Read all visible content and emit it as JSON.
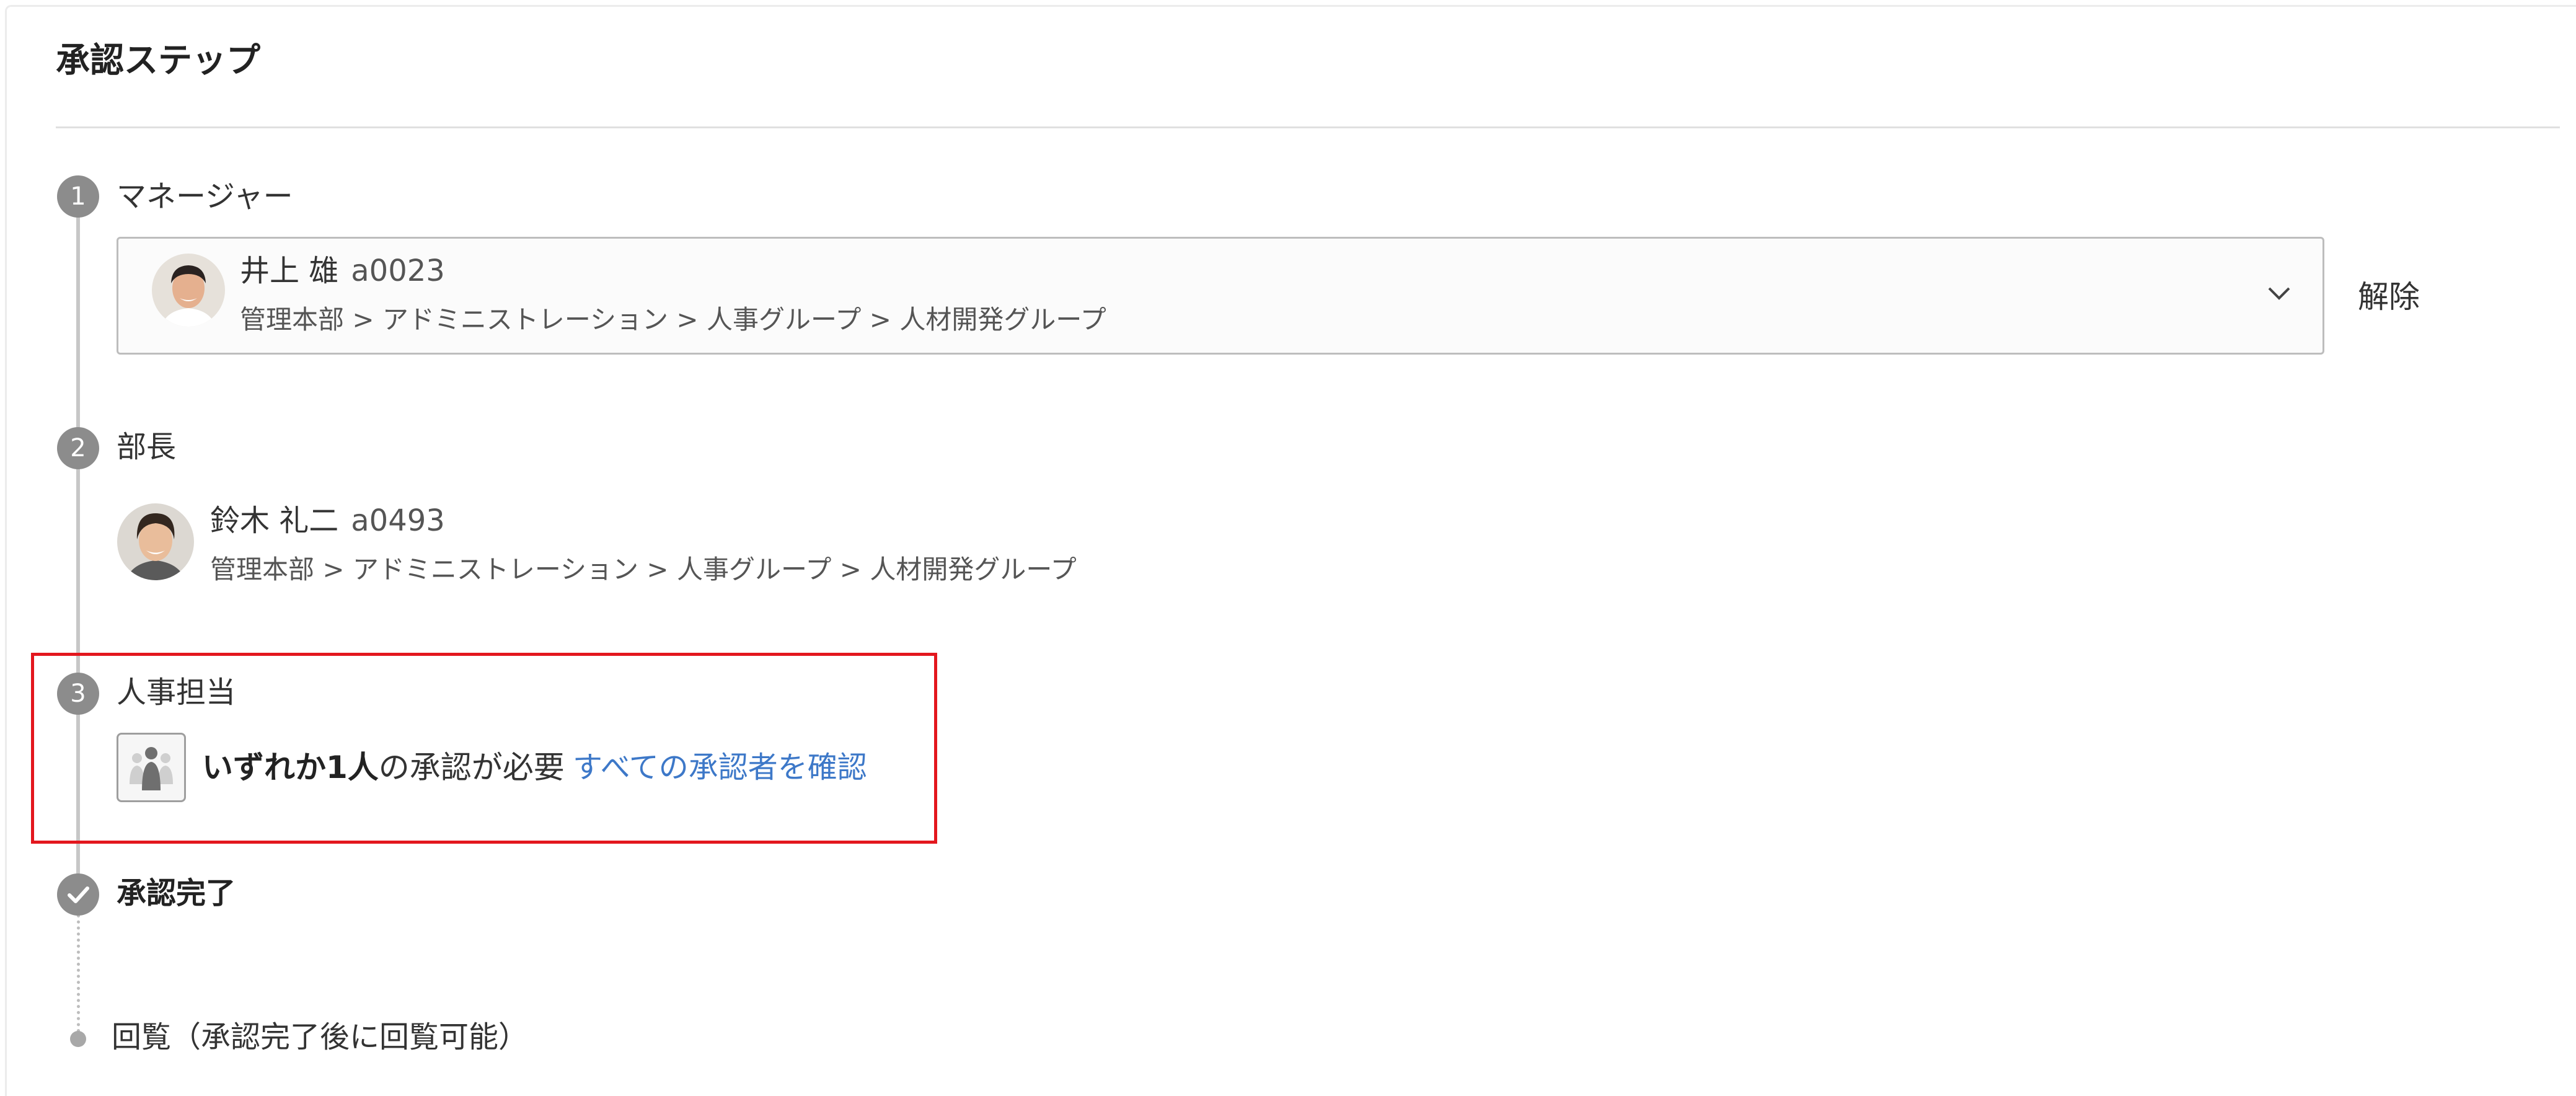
{
  "header": {
    "title": "承認ステップ"
  },
  "steps": [
    {
      "number": "1",
      "label": "マネージャー",
      "approver": {
        "name": "井上 雄",
        "code": "a0023",
        "department": "管理本部 > アドミニストレーション > 人事グループ > 人材開発グループ",
        "avatar_icon": "person-avatar-icon"
      },
      "dropdown_icon": "chevron-down-icon",
      "clear_label": "解除"
    },
    {
      "number": "2",
      "label": "部長",
      "approver": {
        "name": "鈴木 礼二",
        "code": "a0493",
        "department": "管理本部 > アドミニストレーション > 人事グループ > 人材開発グループ",
        "avatar_icon": "person-avatar-icon"
      }
    },
    {
      "number": "3",
      "label": "人事担当",
      "group_icon": "group-icon",
      "requirement_bold": "いずれか1人",
      "requirement_rest": "の承認が必要",
      "link_label": "すべての承認者を確認"
    }
  ],
  "complete": {
    "label": "承認完了",
    "icon": "check-icon"
  },
  "circulation": {
    "label": "回覧（承認完了後に回覧可能）"
  },
  "colors": {
    "step_circle": "#8c8c8c",
    "link": "#3d78c8",
    "highlight_border": "#e3171e",
    "timeline_line": "#c7c7c7"
  }
}
